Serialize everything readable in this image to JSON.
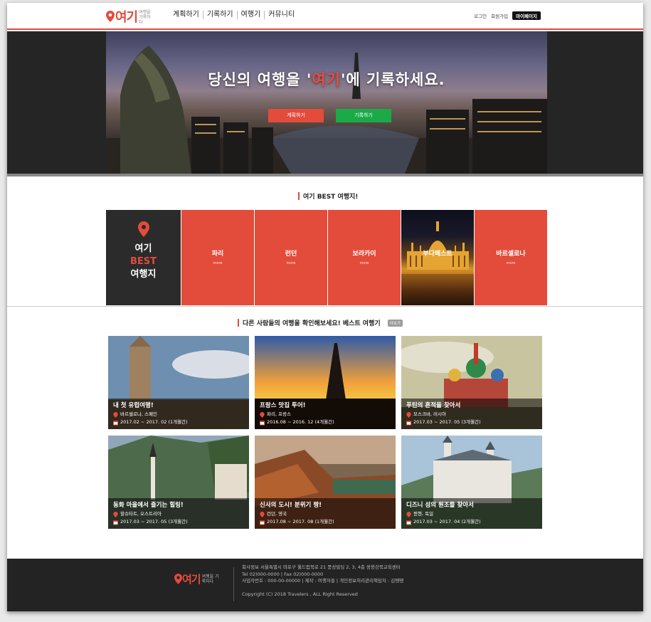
{
  "brand": {
    "name": "여기",
    "tagline": "여행을 기록하다",
    "accent": "#e34b3b"
  },
  "nav": [
    {
      "label": "계획하기"
    },
    {
      "label": "기록하기"
    },
    {
      "label": "여행기"
    },
    {
      "label": "커뮤니티"
    }
  ],
  "util": {
    "login": "로그인",
    "signup": "회원가입",
    "mypage": "마이페이지"
  },
  "hero": {
    "title_before": "당신의 여행을 '",
    "title_accent": "여기",
    "title_after": "'에 기록하세요.",
    "btn_plan": "계획하기",
    "btn_record": "기록하기"
  },
  "best": {
    "section_title": "여기 BEST 여행지!",
    "lead": {
      "l1": "여기",
      "l2": "BEST",
      "l3": "여행지"
    },
    "cities": [
      {
        "name": "파리",
        "more": "more"
      },
      {
        "name": "런던",
        "more": "more"
      },
      {
        "name": "보라카이",
        "more": "more"
      },
      {
        "name": "부다페스트",
        "more": "more"
      },
      {
        "name": "바르셀로나",
        "more": "more"
      }
    ]
  },
  "trips": {
    "section_title": "다른 사람들의 여행을 확인해보세요! 베스트 여행기",
    "see_more": "더보기",
    "items": [
      {
        "title": "내 첫 유럽여행!",
        "place": "바르셀로나, 스페인",
        "period": "2017.02 ~ 2017. 02 (1개월간)"
      },
      {
        "title": "프랑스 맛집 투어!",
        "place": "파리, 프랑스",
        "period": "2016.08 ~ 2016. 12 (4개월간)"
      },
      {
        "title": "푸틴의 흔적을 찾아서",
        "place": "모스크바, 러시아",
        "period": "2017.03 ~ 2017. 05 (3개월간)"
      },
      {
        "title": "동화 마을에서 즐기는 힐링!",
        "place": "할슈타트, 오스트리아",
        "period": "2017.03 ~ 2017. 05 (3개월간)"
      },
      {
        "title": "신사의 도시! 분위기 짱!",
        "place": "런던, 영국",
        "period": "2017.08 ~ 2017. 08 (1개월간)"
      },
      {
        "title": "디즈니 성의 원조를 찾아서",
        "place": "뮌헨, 독일",
        "period": "2017.03 ~ 2017. 04 (2개월간)"
      }
    ]
  },
  "footer": {
    "logo": "여기",
    "tagline": "여행을 기록하다",
    "line1": "회사정보 서울특별시 마포구 월드컵북로 21 풍성빌딩 2, 3, 4층 쌍용강북교육센터",
    "line2": "Tel 02)000-0000 | Fax 02)000-0000",
    "line3": "사업자번호 : 000-00-00000 | 제작 : 여행자들 | 개인정보처리관리책임자 : 김땡땡",
    "copyright": "Copyright (C) 2018 Travelers , ALL Right Reserved"
  }
}
